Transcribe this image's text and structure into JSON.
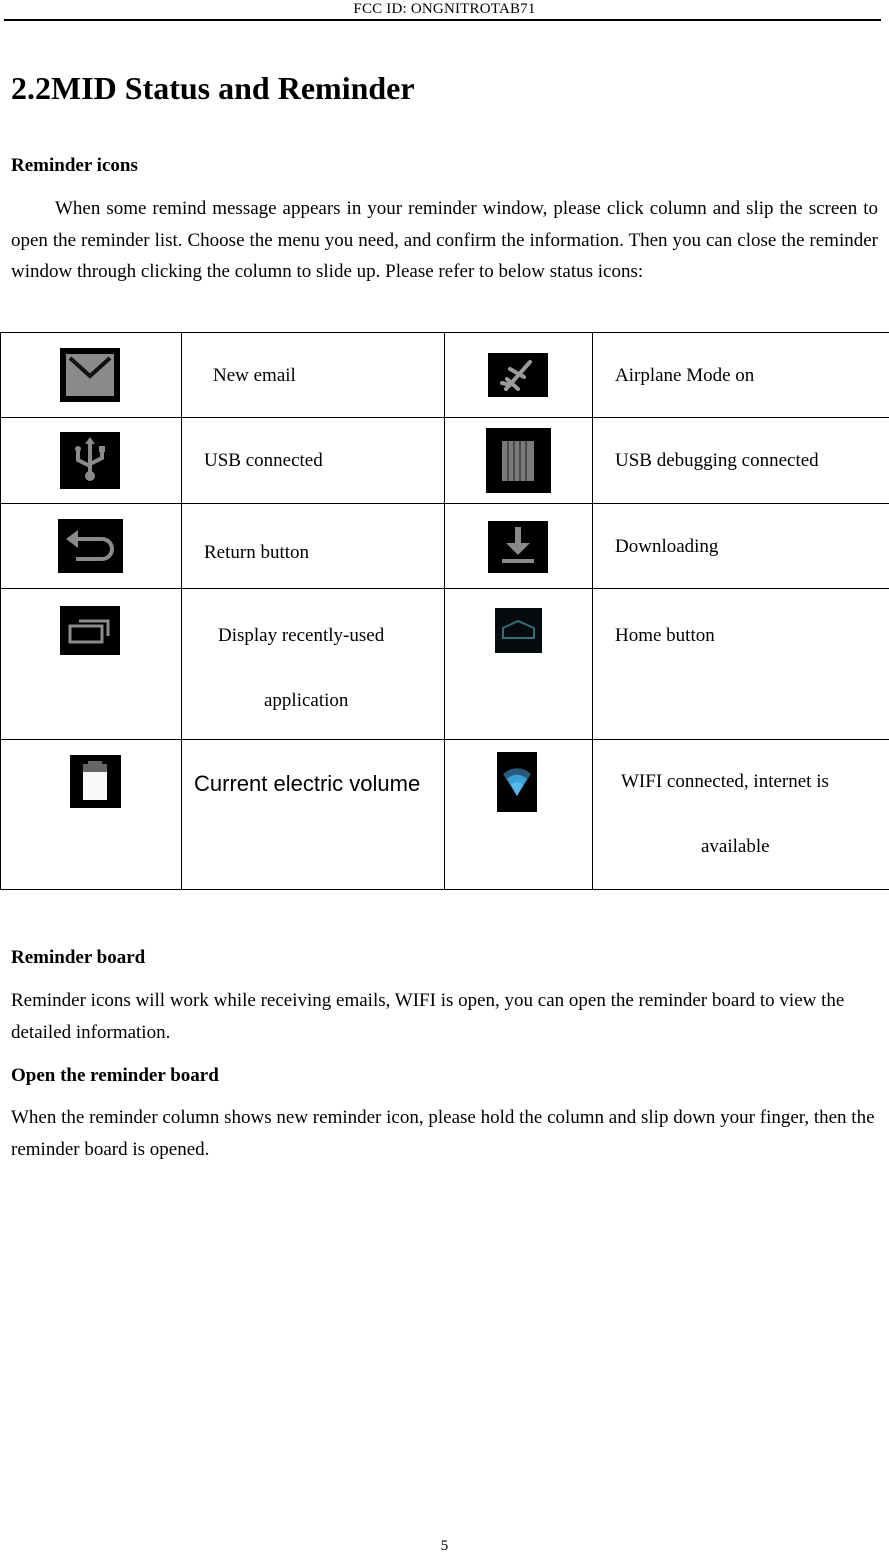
{
  "header": {
    "text": "FCC ID: ONGNITROTAB71"
  },
  "section": {
    "title": "2.2MID Status and Reminder"
  },
  "reminder_icons": {
    "heading": "Reminder icons",
    "paragraph": "When some remind message appears in your reminder window, please click column and slip the screen to open the reminder list. Choose the menu you need, and confirm the information. Then you can close the reminder window through clicking the column to slide up. Please refer to below status icons:"
  },
  "icon_table": {
    "rows": [
      {
        "left": {
          "icon": "email-icon",
          "label": "New email"
        },
        "right": {
          "icon": "airplane-icon",
          "label": "Airplane Mode on"
        }
      },
      {
        "left": {
          "icon": "usb-icon",
          "label": "USB connected"
        },
        "right": {
          "icon": "usb-debugging-icon",
          "label": "USB debugging connected"
        }
      },
      {
        "left": {
          "icon": "return-icon",
          "label": "Return button"
        },
        "right": {
          "icon": "download-icon",
          "label": "Downloading"
        }
      },
      {
        "left": {
          "icon": "recent-apps-icon",
          "label_line1": "Display recently-used",
          "label_line2": "application"
        },
        "right": {
          "icon": "home-icon",
          "label": "Home button"
        }
      },
      {
        "left": {
          "icon": "battery-icon",
          "label": "Current electric volume"
        },
        "right": {
          "icon": "wifi-icon",
          "label_line1": "WIFI connected, internet is",
          "label_line2": "available"
        }
      }
    ],
    "colors": {
      "icon_gray": "#8a8a8a",
      "home_teal": "#2f6f7a",
      "wifi_blue": "#3aa0d8"
    }
  },
  "reminder_board": {
    "heading": "Reminder board",
    "paragraph": "Reminder icons will work while receiving emails, WIFI is open, you can open the reminder board to view the detailed information."
  },
  "open_board": {
    "heading": "Open the reminder board",
    "paragraph": "When the reminder column shows new reminder icon, please hold the column and slip down your finger, then the reminder board is opened."
  },
  "footer": {
    "page_number": "5"
  }
}
